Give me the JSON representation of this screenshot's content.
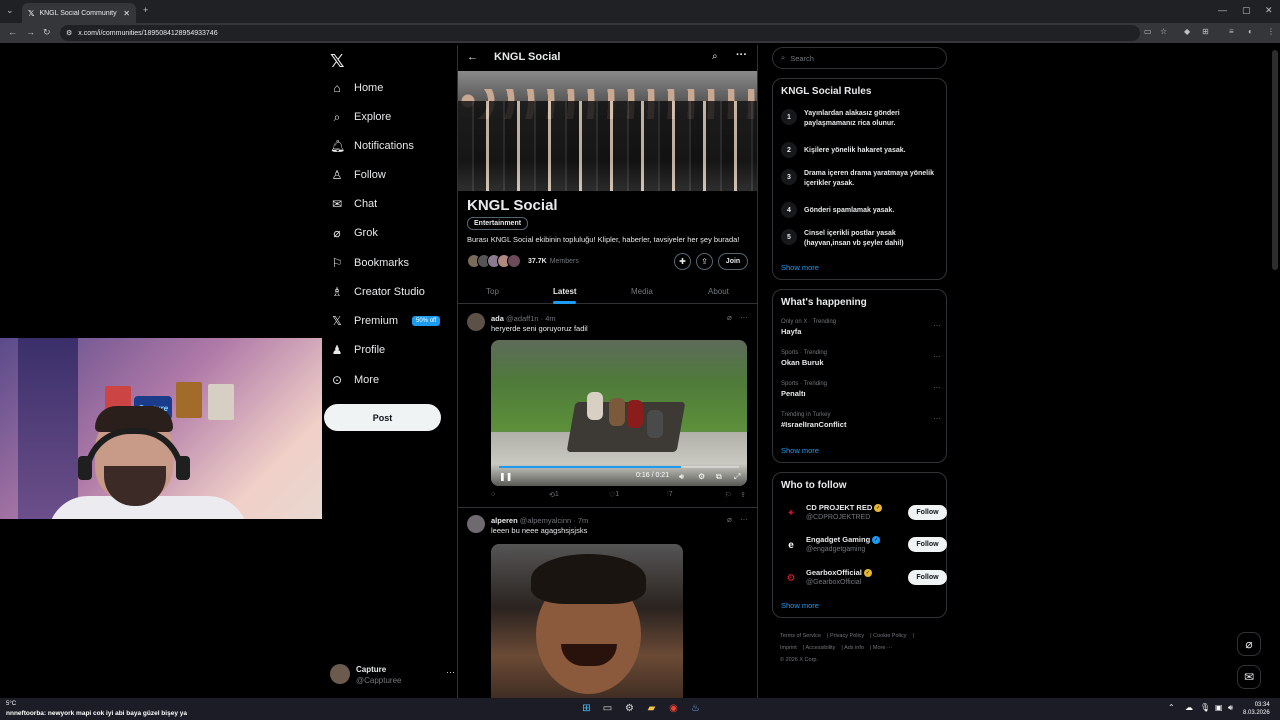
{
  "browser": {
    "tab_title": "KNGL Social Community / X",
    "url": "x.com/i/communities/1895084128954933746"
  },
  "nav": {
    "items": [
      {
        "label": "Home",
        "icon": "home-icon"
      },
      {
        "label": "Explore",
        "icon": "search-icon"
      },
      {
        "label": "Notifications",
        "icon": "bell-icon"
      },
      {
        "label": "Follow",
        "icon": "person-plus-icon"
      },
      {
        "label": "Chat",
        "icon": "mail-icon"
      },
      {
        "label": "Grok",
        "icon": "grok-icon"
      },
      {
        "label": "Bookmarks",
        "icon": "bookmark-icon"
      },
      {
        "label": "Creator Studio",
        "icon": "creator-icon"
      },
      {
        "label": "Premium",
        "icon": "x-icon"
      },
      {
        "label": "Profile",
        "icon": "person-icon"
      },
      {
        "label": "More",
        "icon": "more-circle-icon"
      }
    ],
    "premium_badge": "50% off",
    "post_button": "Post"
  },
  "account": {
    "name": "Capture",
    "handle": "@Cappturee"
  },
  "community": {
    "header_title": "KNGL Social",
    "title": "KNGL Social",
    "category": "Entertainment",
    "description": "Burası KNGL Social ekibinin topluluğu! Klipler, haberler, tavsiyeler her şey burada!",
    "members_count": "37.7K",
    "members_label": "Members",
    "join_label": "Join",
    "tabs": [
      "Top",
      "Latest",
      "Media",
      "About"
    ]
  },
  "posts": [
    {
      "name": "ada",
      "handle": "@adaff1n",
      "time": "4m",
      "text": "heryerde seni goruyoruz fadil",
      "video_time": "0:16 / 0:21",
      "video_progress": 0.76,
      "reposts": "1",
      "likes": "1",
      "views": "7"
    },
    {
      "name": "alperen",
      "handle": "@alpemyalcinn",
      "time": "7m",
      "text": "leeen bu neee agagshsjsjsks"
    }
  ],
  "search": {
    "placeholder": "Search"
  },
  "rules": {
    "title": "KNGL Social Rules",
    "items": [
      {
        "num": "1",
        "text": "Yayınlardan alakasız gönderi paylaşmamanız rica olunur."
      },
      {
        "num": "2",
        "text": "Kişilere yönelik hakaret yasak."
      },
      {
        "num": "3",
        "text": "Drama içeren drama yaratmaya yönelik içerikler yasak."
      },
      {
        "num": "4",
        "text": "Gönderi spamlamak yasak."
      },
      {
        "num": "5",
        "text": "Cinsel içerikli postlar yasak (hayvan,insan vb şeyler dahil)"
      }
    ],
    "show_more": "Show more"
  },
  "happening": {
    "title": "What's happening",
    "trends": [
      {
        "category": "Only on X · Trending",
        "name": "Hayfa"
      },
      {
        "category": "Sports · Trending",
        "name": "Okan Buruk"
      },
      {
        "category": "Sports · Trending",
        "name": "Penaltı"
      },
      {
        "category": "Trending in Turkey",
        "name": "#IsraelIranConflict"
      }
    ],
    "show_more": "Show more"
  },
  "who_to_follow": {
    "title": "Who to follow",
    "accounts": [
      {
        "name": "CD PROJEKT RED",
        "handle": "@CDPROJEKTRED",
        "verified_color": "#e8b730",
        "logo_color": "#c8102e"
      },
      {
        "name": "Engadget Gaming",
        "handle": "@engadgetgaming",
        "verified_color": "#1d9bf0",
        "logo_color": "#ffffff"
      },
      {
        "name": "GearboxOfficial",
        "handle": "@GearboxOfficial",
        "verified_color": "#e8b730",
        "logo_color": "#e3262d"
      }
    ],
    "follow_label": "Follow",
    "show_more": "Show more"
  },
  "footer": {
    "links": [
      "Terms of Service",
      "Privacy Policy",
      "Cookie Policy",
      "Imprint",
      "Accessibility",
      "Ads info",
      "More ···"
    ],
    "copyright": "© 2026 X Corp."
  },
  "webcam": {
    "logo_text": "Capture"
  },
  "taskbar": {
    "weather": "5°C",
    "ticker": "nnneftoorba: newyork mapi cok iyi abi baya güzel bişey ya",
    "time": "03:34",
    "date": "8.03.2026"
  },
  "colors": {
    "accent": "#1d9bf0",
    "background": "#000000",
    "border": "#2f3336"
  }
}
